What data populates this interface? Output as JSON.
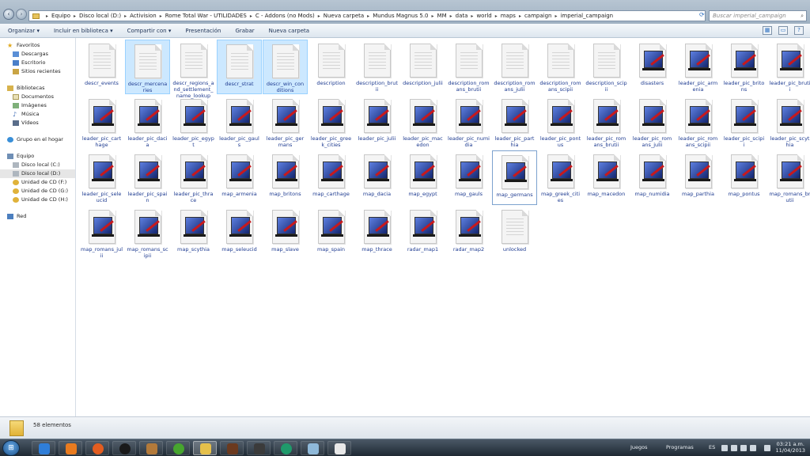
{
  "window": {
    "breadcrumb": [
      "Equipo",
      "Disco local (D:)",
      "Activision",
      "Rome Total War - UTILIDADES",
      "C - Addons (no Mods)",
      "Nueva carpeta",
      "Mundus Magnus 5.0",
      "MM",
      "data",
      "world",
      "maps",
      "campaign",
      "imperial_campaign"
    ],
    "search_placeholder": "Buscar imperial_campaign"
  },
  "toolbar": {
    "organize": "Organizar ▾",
    "include": "Incluir en biblioteca ▾",
    "share": "Compartir con ▾",
    "presentation": "Presentación",
    "burn": "Grabar",
    "new_folder": "Nueva carpeta"
  },
  "sidebar": {
    "favorites": "Favoritos",
    "downloads": "Descargas",
    "desktop": "Escritorio",
    "recent": "Sitios recientes",
    "libraries": "Bibliotecas",
    "documents": "Documentos",
    "images": "Imágenes",
    "music": "Música",
    "videos": "Vídeos",
    "homegroup": "Grupo en el hogar",
    "computer": "Equipo",
    "disk_c": "Disco local (C:)",
    "disk_d": "Disco local (D:)",
    "cd_f": "Unidad de CD (F:)",
    "cd_g": "Unidad de CD (G:)",
    "cd_h": "Unidad de CD (H:)",
    "network": "Red"
  },
  "files": [
    {
      "name": "descr_events",
      "type": "text"
    },
    {
      "name": "descr_mercenaries",
      "type": "text",
      "selected": true
    },
    {
      "name": "descr_regions_and_settlement_name_lookup",
      "type": "text"
    },
    {
      "name": "descr_strat",
      "type": "text",
      "selected": true
    },
    {
      "name": "descr_win_conditions",
      "type": "text",
      "selected": true
    },
    {
      "name": "description",
      "type": "text"
    },
    {
      "name": "description_brutii",
      "type": "text"
    },
    {
      "name": "description_julii",
      "type": "text"
    },
    {
      "name": "description_romans_brutii",
      "type": "text"
    },
    {
      "name": "description_romans_julii",
      "type": "text"
    },
    {
      "name": "description_romans_scipii",
      "type": "text"
    },
    {
      "name": "description_scipii",
      "type": "text"
    },
    {
      "name": "disasters",
      "type": "image"
    },
    {
      "name": "leader_pic_armenia",
      "type": "image"
    },
    {
      "name": "leader_pic_britons",
      "type": "image"
    },
    {
      "name": "leader_pic_brutii",
      "type": "image"
    },
    {
      "name": "leader_pic_carthage",
      "type": "image"
    },
    {
      "name": "leader_pic_dacia",
      "type": "image"
    },
    {
      "name": "leader_pic_egypt",
      "type": "image"
    },
    {
      "name": "leader_pic_gauls",
      "type": "image"
    },
    {
      "name": "leader_pic_germans",
      "type": "image"
    },
    {
      "name": "leader_pic_greek_cities",
      "type": "image"
    },
    {
      "name": "leader_pic_julii",
      "type": "image"
    },
    {
      "name": "leader_pic_macedon",
      "type": "image"
    },
    {
      "name": "leader_pic_numidia",
      "type": "image"
    },
    {
      "name": "leader_pic_parthia",
      "type": "image"
    },
    {
      "name": "leader_pic_pontus",
      "type": "image"
    },
    {
      "name": "leader_pic_romans_brutii",
      "type": "image"
    },
    {
      "name": "leader_pic_romans_julii",
      "type": "image"
    },
    {
      "name": "leader_pic_romans_scipii",
      "type": "image"
    },
    {
      "name": "leader_pic_scipii",
      "type": "image"
    },
    {
      "name": "leader_pic_scythia",
      "type": "image"
    },
    {
      "name": "leader_pic_seleucid",
      "type": "image"
    },
    {
      "name": "leader_pic_spain",
      "type": "image"
    },
    {
      "name": "leader_pic_thrace",
      "type": "image"
    },
    {
      "name": "map_armenia",
      "type": "image"
    },
    {
      "name": "map_britons",
      "type": "image"
    },
    {
      "name": "map_carthage",
      "type": "image"
    },
    {
      "name": "map_dacia",
      "type": "image"
    },
    {
      "name": "map_egypt",
      "type": "image"
    },
    {
      "name": "map_gauls",
      "type": "image"
    },
    {
      "name": "map_germans",
      "type": "image",
      "focused": true
    },
    {
      "name": "map_greek_cities",
      "type": "image"
    },
    {
      "name": "map_macedon",
      "type": "image"
    },
    {
      "name": "map_numidia",
      "type": "image"
    },
    {
      "name": "map_parthia",
      "type": "image"
    },
    {
      "name": "map_pontus",
      "type": "image"
    },
    {
      "name": "map_romans_brutii",
      "type": "image"
    },
    {
      "name": "map_romans_julii",
      "type": "image"
    },
    {
      "name": "map_romans_scipii",
      "type": "image"
    },
    {
      "name": "map_scythia",
      "type": "image"
    },
    {
      "name": "map_seleucid",
      "type": "image"
    },
    {
      "name": "map_slave",
      "type": "image"
    },
    {
      "name": "map_spain",
      "type": "image"
    },
    {
      "name": "map_thrace",
      "type": "image"
    },
    {
      "name": "radar_map1",
      "type": "image"
    },
    {
      "name": "radar_map2",
      "type": "image"
    },
    {
      "name": "unlocked",
      "type": "text"
    }
  ],
  "status": {
    "count": "58 elementos"
  },
  "taskbar": {
    "games": "Juegos",
    "programs": "Programas",
    "lang": "ES",
    "time": "03:21 a.m.",
    "date": "11/04/2013"
  }
}
